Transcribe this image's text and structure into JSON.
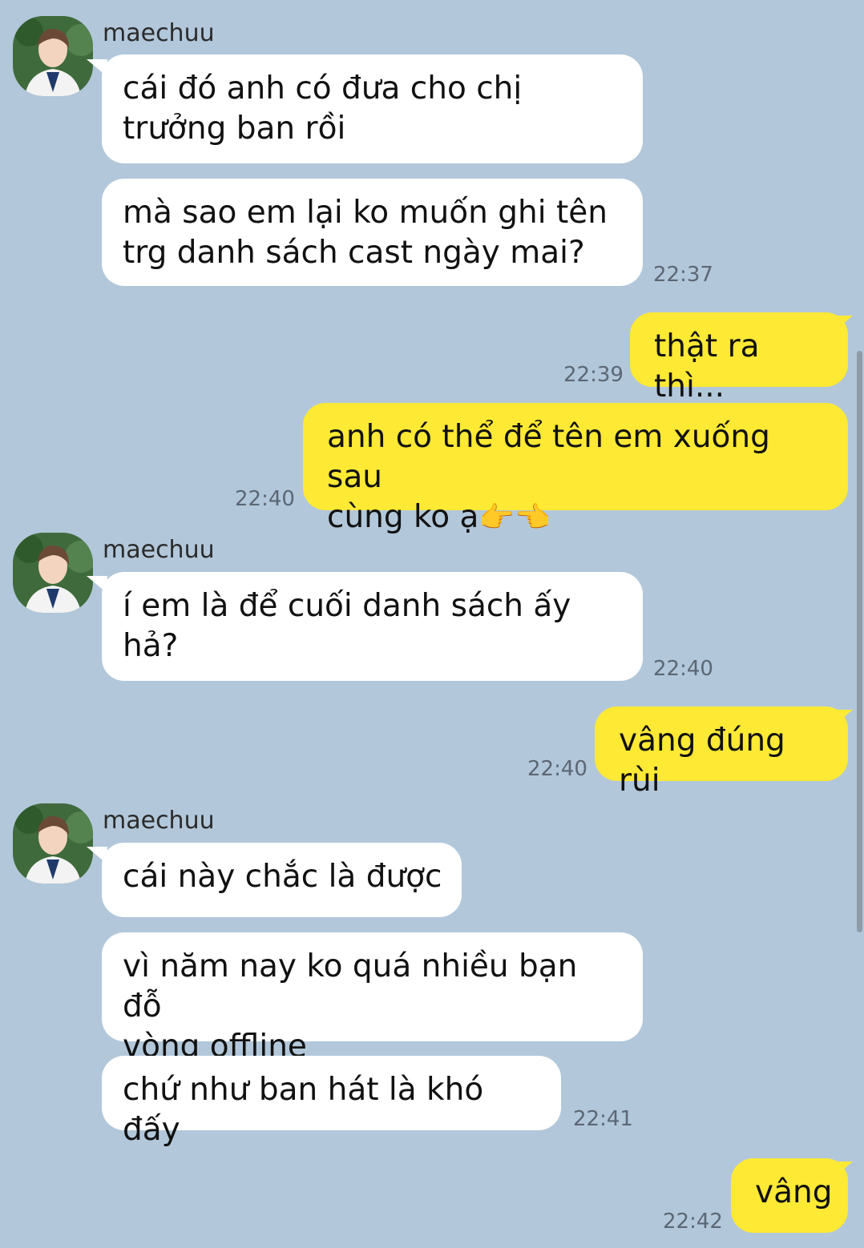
{
  "contact": {
    "name": "maechuu"
  },
  "messages": [
    {
      "text": "cái đó anh có đưa cho chị\ntrưởng ban rồi"
    },
    {
      "text": "mà sao em lại ko muốn ghi tên\ntrg danh sách cast ngày mai?",
      "time": "22:37"
    },
    {
      "text": "thật ra thì...",
      "time": "22:39"
    },
    {
      "text": "anh có thể để tên em xuống sau\ncùng ko ạ",
      "emoji": "👉👈",
      "time": "22:40"
    },
    {
      "text": "í em là để cuối danh sách ấy\nhả?",
      "time": "22:40"
    },
    {
      "text": "vâng đúng rùi",
      "time": "22:40"
    },
    {
      "text": "cái này chắc là được"
    },
    {
      "text": "vì năm nay ko quá nhiều bạn đỗ\nvòng offline"
    },
    {
      "text": "chứ như ban hát là khó đấy",
      "time": "22:41"
    },
    {
      "text": "vâng",
      "time": "22:42"
    }
  ],
  "colors": {
    "background": "#b2c7da",
    "incoming_bubble": "#ffffff",
    "outgoing_bubble": "#fee934"
  },
  "icons": {
    "avatar": "profile-photo"
  }
}
